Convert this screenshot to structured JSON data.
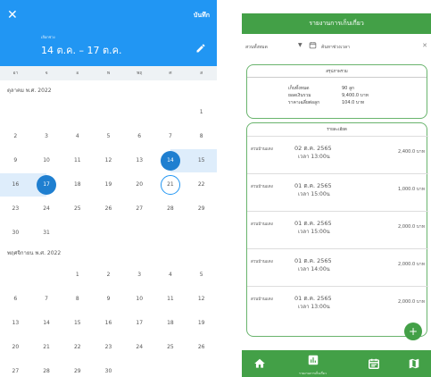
{
  "picker": {
    "close_glyph": "✕",
    "save_label": "บันทึก",
    "sublabel": "เลือกช่วง",
    "range_label": "14 ต.ค. – 17 ต.ค.",
    "weekdays": [
      "อา",
      "จ",
      "อ",
      "พ",
      "พฤ",
      "ศ",
      "ส"
    ],
    "months": [
      {
        "title": "ตุลาคม พ.ศ. 2022",
        "weeks": [
          [
            "",
            "",
            "",
            "",
            "",
            "",
            "1"
          ],
          [
            "2",
            "3",
            "4",
            "5",
            "6",
            "7",
            "8"
          ],
          [
            "9",
            "10",
            "11",
            "12",
            "13",
            "14",
            "15"
          ],
          [
            "16",
            "17",
            "18",
            "19",
            "20",
            "21",
            "22"
          ],
          [
            "23",
            "24",
            "25",
            "26",
            "27",
            "28",
            "29"
          ],
          [
            "30",
            "31",
            "",
            "",
            "",
            "",
            ""
          ]
        ]
      },
      {
        "title": "พฤศจิกายน พ.ศ. 2022",
        "weeks": [
          [
            "",
            "",
            "1",
            "2",
            "3",
            "4",
            "5"
          ],
          [
            "6",
            "7",
            "8",
            "9",
            "10",
            "11",
            "12"
          ],
          [
            "13",
            "14",
            "15",
            "16",
            "17",
            "18",
            "19"
          ],
          [
            "20",
            "21",
            "22",
            "23",
            "24",
            "25",
            "26"
          ],
          [
            "27",
            "28",
            "29",
            "30",
            "",
            "",
            ""
          ]
        ]
      }
    ],
    "selected_start": "14",
    "selected_end": "17",
    "today": "21",
    "accent_color": "#2196f3",
    "range_color": "#deedfb"
  },
  "report": {
    "title": "รายงานการเก็บเกี่ยว",
    "filter_location": "สวนทั้งหมด",
    "filter_date_placeholder": "ค้นหาช่วงเวลา",
    "summary": {
      "title": "สรุปภาพรวม",
      "rows": [
        {
          "label": "เก็บทั้งหมด",
          "value": "90",
          "unit": "ลูก"
        },
        {
          "label": "ยอดเงินรวม",
          "value": "9,400.0",
          "unit": "บาท"
        },
        {
          "label": "ราคาเฉลี่ยต่อลูก",
          "value": "104.0",
          "unit": "บาท"
        }
      ]
    },
    "details": {
      "title": "รายละเอียด",
      "items": [
        {
          "location": "สวนบ้านแดง",
          "date": "02 ต.ค. 2565",
          "time": "เวลา 13:00น",
          "amount": "2,400.0 บาท"
        },
        {
          "location": "สวนบ้านแดง",
          "date": "01 ต.ค. 2565",
          "time": "เวลา 15:00น",
          "amount": "1,000.0 บาท"
        },
        {
          "location": "สวนบ้านแดง",
          "date": "01 ต.ค. 2565",
          "time": "เวลา 15:00น",
          "amount": "2,000.0 บาท"
        },
        {
          "location": "สวนบ้านแดง",
          "date": "01 ต.ค. 2565",
          "time": "เวลา 14:00น",
          "amount": "2,000.0 บาท"
        },
        {
          "location": "สวนบ้านแดง",
          "date": "01 ต.ค. 2565",
          "time": "เวลา 13:00น",
          "amount": "2,000.0 บาท"
        }
      ]
    },
    "fab_glyph": "+",
    "bottom_nav": {
      "active_label": "รายงานการเก็บเกี่ยว",
      "icons": [
        "home-icon",
        "bar-chart-icon",
        "calendar-icon",
        "map-icon"
      ]
    },
    "brand_color": "#43a047"
  }
}
